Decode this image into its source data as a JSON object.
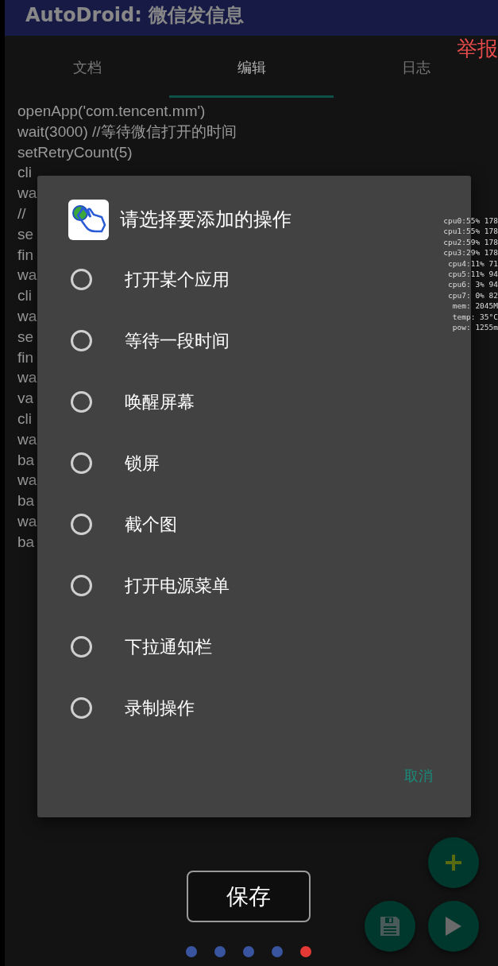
{
  "app_bar": {
    "title": "AutoDroid: 微信发信息"
  },
  "report_link": "举报",
  "tabs": [
    {
      "label": "文档",
      "selected": false
    },
    {
      "label": "编辑",
      "selected": true
    },
    {
      "label": "日志",
      "selected": false
    }
  ],
  "code_lines": [
    "openApp('com.tencent.mm')",
    "wait(3000) //等待微信打开的时间",
    "setRetryCount(5)",
    "cli",
    "wa",
    "//",
    "se",
    "fin",
    "wa",
    "cli",
    "wa",
    "se",
    "fin",
    "wa",
    "va",
    "cli",
    "wa",
    "ba",
    "wa",
    "ba",
    "wa",
    "ba"
  ],
  "perf_overlay": [
    "cpu0:55% 178",
    "cpu1:55% 178",
    "cpu2:59% 178",
    "cpu3:29% 178",
    "cpu4:11% 71",
    "cpu5:11% 94",
    "cpu6: 3% 94",
    "cpu7: 0% 82",
    "mem: 2045M",
    "temp: 35°C",
    "pow: 1255m"
  ],
  "dialog": {
    "title": "请选择要添加的操作",
    "options": [
      {
        "label": "打开某个应用",
        "selected": false
      },
      {
        "label": "等待一段时间",
        "selected": false
      },
      {
        "label": "唤醒屏幕",
        "selected": false
      },
      {
        "label": "锁屏",
        "selected": false
      },
      {
        "label": "截个图",
        "selected": false
      },
      {
        "label": "打开电源菜单",
        "selected": false
      },
      {
        "label": "下拉通知栏",
        "selected": false
      },
      {
        "label": "录制操作",
        "selected": false
      }
    ],
    "cancel": "取消"
  },
  "save_button": "保存",
  "page_dots": [
    {
      "selected": false
    },
    {
      "selected": false
    },
    {
      "selected": false
    },
    {
      "selected": false
    },
    {
      "selected": true
    }
  ],
  "fabs": [
    {
      "kind": "add"
    },
    {
      "kind": "save"
    },
    {
      "kind": "run"
    }
  ]
}
